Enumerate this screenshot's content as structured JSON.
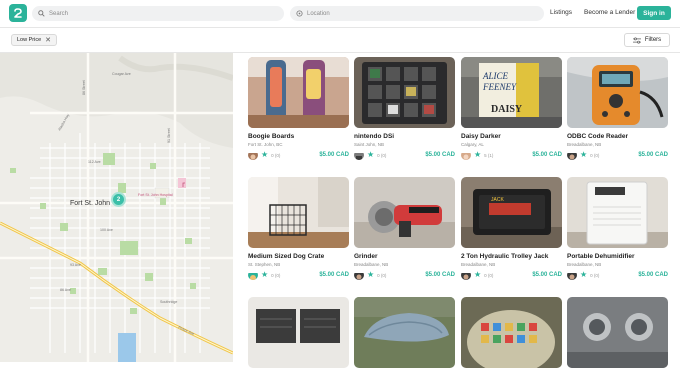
{
  "header": {
    "search_placeholder": "Search",
    "location_placeholder": "Location",
    "nav": [
      "Listings",
      "Become a Lender"
    ],
    "signin_label": "Sign in"
  },
  "filters": {
    "chip_label": "Low Price",
    "button_label": "Filters"
  },
  "map": {
    "city_label": "Fort St. John",
    "cluster_count": "2",
    "hospital_label": "Fort St. John Hospital",
    "street_labels": [
      "Cougar Ave",
      "86 Street",
      "Alaska Hwy",
      "91 Street",
      "112 Ave",
      "100 Ave",
      "93 Ave",
      "86 Ave",
      "Southridge",
      "Peace Ave"
    ]
  },
  "listings": [
    {
      "title": "Boogie Boards",
      "location": "Fort St. John, BC",
      "rating": "0 (0)",
      "price": "$5.00 CAD",
      "icon": "boogie-boards-photo"
    },
    {
      "title": "nintendo DSi",
      "location": "Saint John, NB",
      "rating": "0 (0)",
      "price": "$5.00 CAD",
      "icon": "nintendo-dsi-photo"
    },
    {
      "title": "Daisy Darker",
      "location": "Calgary, AL",
      "rating": "5 (1)",
      "price": "$5.00 CAD",
      "icon": "book-photo"
    },
    {
      "title": "ODBC Code Reader",
      "location": "Breadalbane, NB",
      "rating": "0 (0)",
      "price": "$5.00 CAD",
      "icon": "code-reader-photo"
    },
    {
      "title": "Medium Sized Dog Crate",
      "location": "St. Stephen, NB",
      "rating": "0 (0)",
      "price": "$5.00 CAD",
      "icon": "dog-crate-photo"
    },
    {
      "title": "Grinder",
      "location": "Breadalbane, NB",
      "rating": "0 (0)",
      "price": "$5.00 CAD",
      "icon": "grinder-photo"
    },
    {
      "title": "2 Ton Hydraulic Trolley Jack",
      "location": "Breadalbane, NB",
      "rating": "0 (0)",
      "price": "$5.00 CAD",
      "icon": "trolley-jack-photo"
    },
    {
      "title": "Portable Dehumidifier",
      "location": "Breadalbane, NB",
      "rating": "0 (0)",
      "price": "$5.00 CAD",
      "icon": "dehumidifier-photo"
    },
    {
      "title": "",
      "location": "",
      "rating": "",
      "price": "",
      "icon": "crates-photo"
    },
    {
      "title": "",
      "location": "",
      "rating": "",
      "price": "",
      "icon": "cargo-box-photo"
    },
    {
      "title": "",
      "location": "",
      "rating": "",
      "price": "",
      "icon": "game-board-photo"
    },
    {
      "title": "",
      "location": "",
      "rating": "",
      "price": "",
      "icon": "lamps-photo"
    }
  ],
  "colors": {
    "accent": "#2bb39a",
    "map_bg": "#eeede8"
  }
}
